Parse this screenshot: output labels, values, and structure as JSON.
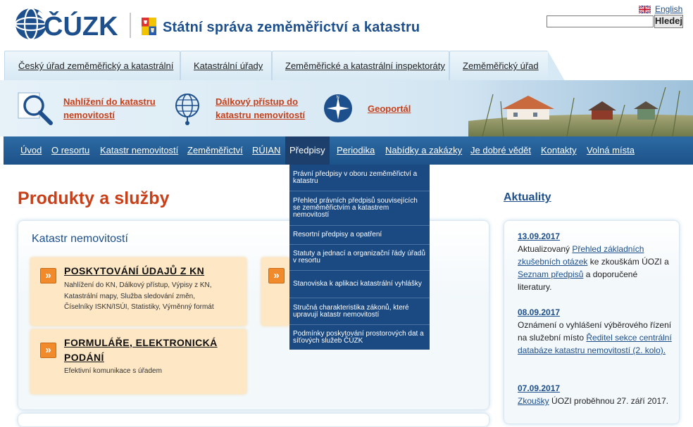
{
  "header": {
    "logo_text": "ČÚZK",
    "title": "Státní správa zeměměřictví a katastru",
    "lang_link": "English",
    "search_placeholder": "",
    "search_button": "Hledej"
  },
  "tabs": [
    {
      "label": "Český úřad zeměměřický a katastrální"
    },
    {
      "label": "Katastrální úřady"
    },
    {
      "label": "Zeměměřické a katastrální inspektoráty"
    },
    {
      "label": "Zeměměřický úřad"
    }
  ],
  "quick_links": [
    {
      "label": "Nahlížení do katastru\nnemovitostí",
      "icon": "magnifier-icon"
    },
    {
      "label": "Dálkový přístup do\nkatastru nemovitostí",
      "icon": "globe-icon"
    },
    {
      "label": "Geoportál",
      "icon": "compass-icon"
    }
  ],
  "nav": [
    {
      "label": "Úvod"
    },
    {
      "label": "O resortu"
    },
    {
      "label": "Katastr nemovitostí"
    },
    {
      "label": "Zeměměřictví"
    },
    {
      "label": "RÚIAN"
    },
    {
      "label": "Předpisy",
      "active": true
    },
    {
      "label": "Periodika"
    },
    {
      "label": "Nabídky a zakázky"
    },
    {
      "label": "Je dobré vědět"
    },
    {
      "label": "Kontakty"
    },
    {
      "label": "Volná místa"
    }
  ],
  "dropdown": [
    {
      "label": "Právní předpisy v oboru zeměměřictví a katastru"
    },
    {
      "label": "Přehled právních předpisů souvisejících se zeměměřictvím a katastrem nemovitostí"
    },
    {
      "label": "Resortní předpisy a opatření"
    },
    {
      "label": "Statuty a jednací a organizační řády úřadů v resortu"
    },
    {
      "label": "Stanoviska k aplikaci katastrální vyhlášky"
    },
    {
      "label": "Stručná charakteristika zákonů, které upravují katastr nemovitostí"
    },
    {
      "label": "Podmínky poskytování prostorových dat a síťových služeb ČÚZK"
    }
  ],
  "main": {
    "title": "Produkty a služby",
    "section_title": "Katastr nemovitostí",
    "cards": [
      {
        "arrow": "»",
        "title": "POSKYTOVÁNÍ ÚDAJŮ Z KN",
        "desc": "Nahlížení do KN, Dálkový přístup, Výpisy z KN,\nKatastrální mapy, Služba sledování změn,\nČíselníky ISKN/ISÚI, Statistiky, Výměnný formát"
      },
      {
        "arrow": "»",
        "title": "",
        "desc": ""
      },
      {
        "arrow": "»",
        "title": "FORMULÁŘE, ELEKTRONICKÁ\nPODÁNÍ",
        "desc": "Efektivní komunikace s úřadem"
      }
    ]
  },
  "news": {
    "title": "Aktuality",
    "items": [
      {
        "date": "13.09.2017",
        "t1": "Aktualizovaný ",
        "l1": "Přehled základních zkušebních otázek",
        "t2": " ke zkouškám ÚOZI a ",
        "l2": "Seznam předpisů",
        "t3": " a doporučené literatury."
      },
      {
        "date": "08.09.2017",
        "t1": "Oznámení o vyhlášení výběrového řízení na služební místo ",
        "l1": "Ředitel sekce centrální databáze katastru nemovitostí (2. kolo).",
        "t2": "",
        "l2": "",
        "t3": ""
      },
      {
        "date": "07.09.2017",
        "t1": "",
        "l1": "Zkoušky",
        "t2": " ÚOZI proběhnou 27. září 2017.",
        "l2": "",
        "t3": ""
      }
    ]
  },
  "colors": {
    "brand_blue": "#1d4f8c",
    "nav_blue": "#2d6aa4",
    "accent_orange": "#c8401a",
    "card_bg": "#fde7c5"
  }
}
